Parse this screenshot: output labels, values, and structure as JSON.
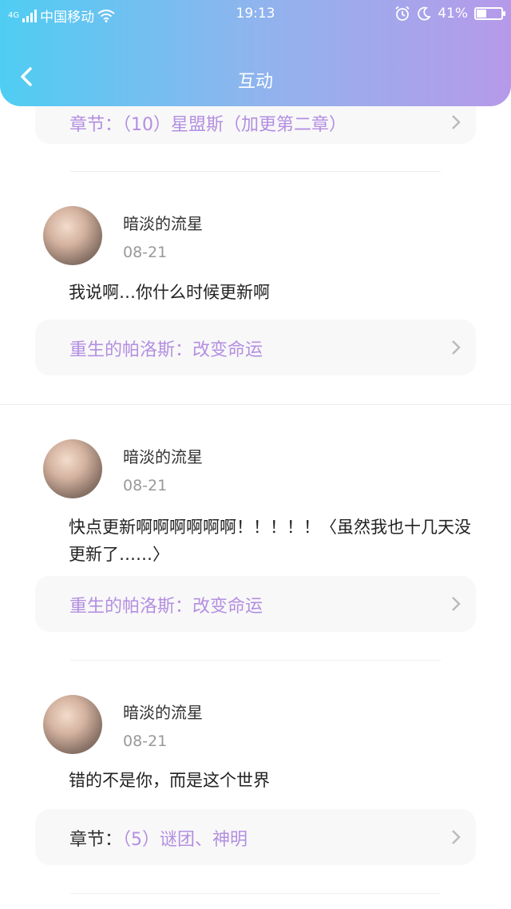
{
  "status_bar": {
    "network": "4G",
    "carrier": "中国移动",
    "time": "19:13",
    "battery": "41%",
    "battery_level": 0.41
  },
  "nav": {
    "title": "互动"
  },
  "top_partial_card": {
    "text": "章节：（10）星盟斯（加更第二章）"
  },
  "comments": [
    {
      "username": "暗淡的流星",
      "date": "08-21",
      "text": "我说啊…你什么时候更新啊",
      "chapter_prefix": "",
      "chapter_title": "重生的帕洛斯：改变命运"
    },
    {
      "username": "暗淡的流星",
      "date": "08-21",
      "text": "快点更新啊啊啊啊啊啊！！！！！〈虽然我也十几天没更新了……〉",
      "chapter_prefix": "",
      "chapter_title": "重生的帕洛斯：改变命运"
    },
    {
      "username": "暗淡的流星",
      "date": "08-21",
      "text": "错的不是你，而是这个世界",
      "chapter_prefix": "章节：",
      "chapter_title": "（5）谜团、神明"
    }
  ],
  "colors": {
    "header_gradient": [
      "#4fcdf3",
      "#8fb4ee",
      "#b69ae9"
    ],
    "chapter_link": "#b38fe0"
  },
  "icons": {
    "back": "chevron-left-icon",
    "chapter_arrow": "chevron-right-icon",
    "wifi": "wifi-icon",
    "alarm": "alarm-icon",
    "moon": "moon-icon",
    "battery": "battery-icon"
  }
}
